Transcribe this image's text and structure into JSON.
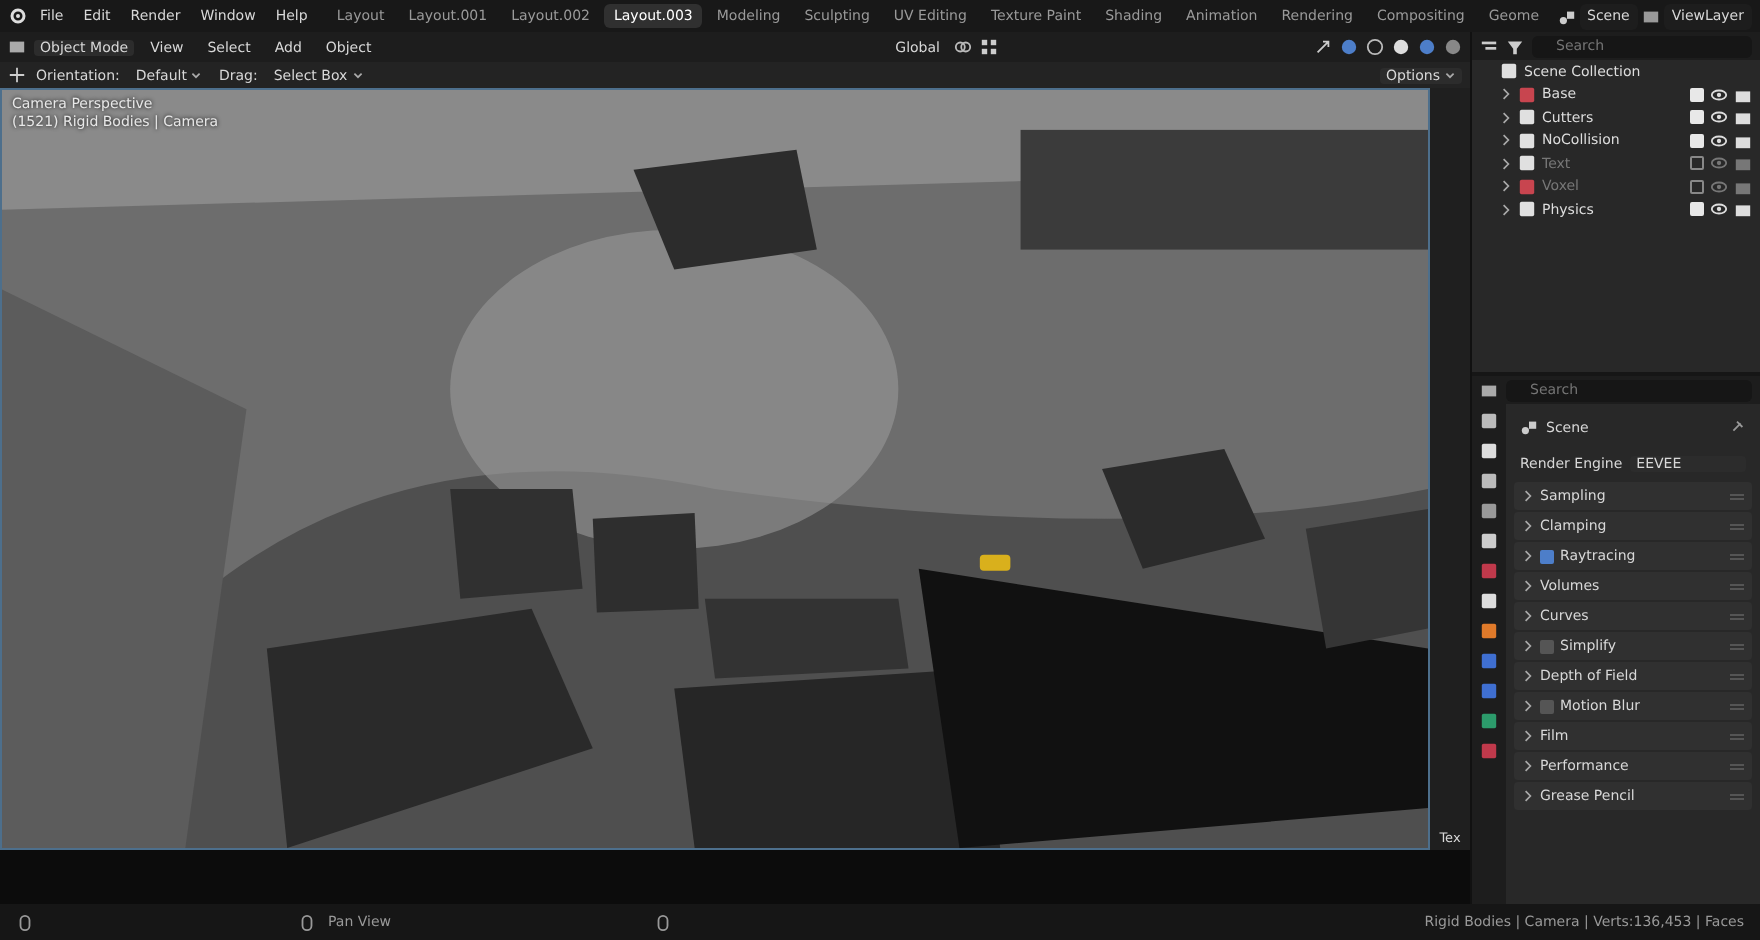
{
  "menu": [
    "File",
    "Edit",
    "Render",
    "Window",
    "Help"
  ],
  "workspaces": [
    {
      "label": "Layout",
      "selected": false
    },
    {
      "label": "Layout.001",
      "selected": false
    },
    {
      "label": "Layout.002",
      "selected": false
    },
    {
      "label": "Layout.003",
      "selected": true
    },
    {
      "label": "Modeling",
      "selected": false
    },
    {
      "label": "Sculpting",
      "selected": false
    },
    {
      "label": "UV Editing",
      "selected": false
    },
    {
      "label": "Texture Paint",
      "selected": false
    },
    {
      "label": "Shading",
      "selected": false
    },
    {
      "label": "Animation",
      "selected": false
    },
    {
      "label": "Rendering",
      "selected": false
    },
    {
      "label": "Compositing",
      "selected": false
    },
    {
      "label": "Geome",
      "selected": false
    }
  ],
  "scene": "Scene",
  "view_layer": "ViewLayer",
  "viewport_header": {
    "mode": "Object Mode",
    "menus": [
      "View",
      "Select",
      "Add",
      "Object"
    ],
    "orientation": "Global"
  },
  "tool_settings": {
    "orientation_label": "Orientation:",
    "orientation": "Default",
    "drag_label": "Drag:",
    "drag": "Select Box",
    "options": "Options"
  },
  "viewport": {
    "camera": "Camera Perspective",
    "info": "(1521) Rigid Bodies | Camera"
  },
  "outliner": {
    "search_placeholder": "Search",
    "root": "Scene Collection",
    "collections": [
      {
        "name": "Base",
        "checked": true,
        "color": "#c8454f"
      },
      {
        "name": "Cutters",
        "checked": true,
        "color": "#e0e0e0"
      },
      {
        "name": "NoCollision",
        "checked": true,
        "color": "#e0e0e0"
      },
      {
        "name": "Text",
        "checked": false,
        "color": "#e0e0e0"
      },
      {
        "name": "Voxel",
        "checked": false,
        "color": "#c8454f"
      },
      {
        "name": "Physics",
        "checked": true,
        "color": "#e0e0e0"
      }
    ]
  },
  "properties": {
    "search_placeholder": "Search",
    "context": "Scene",
    "render_engine_label": "Render Engine",
    "render_engine": "EEVEE",
    "panels": [
      {
        "label": "Sampling",
        "kind": "plain"
      },
      {
        "label": "Clamping",
        "kind": "plain"
      },
      {
        "label": "Raytracing",
        "kind": "toggle",
        "checked": true
      },
      {
        "label": "Volumes",
        "kind": "plain"
      },
      {
        "label": "Curves",
        "kind": "plain"
      },
      {
        "label": "Simplify",
        "kind": "toggle",
        "checked": false
      },
      {
        "label": "Depth of Field",
        "kind": "plain"
      },
      {
        "label": "Motion Blur",
        "kind": "toggle",
        "checked": false
      },
      {
        "label": "Film",
        "kind": "plain"
      },
      {
        "label": "Performance",
        "kind": "plain"
      },
      {
        "label": "Grease Pencil",
        "kind": "plain"
      }
    ]
  },
  "timeline_label": "Tex",
  "status_bar": {
    "hints": [
      "Pan View"
    ],
    "stats": "Rigid Bodies | Camera | Verts:136,453 | Faces"
  }
}
